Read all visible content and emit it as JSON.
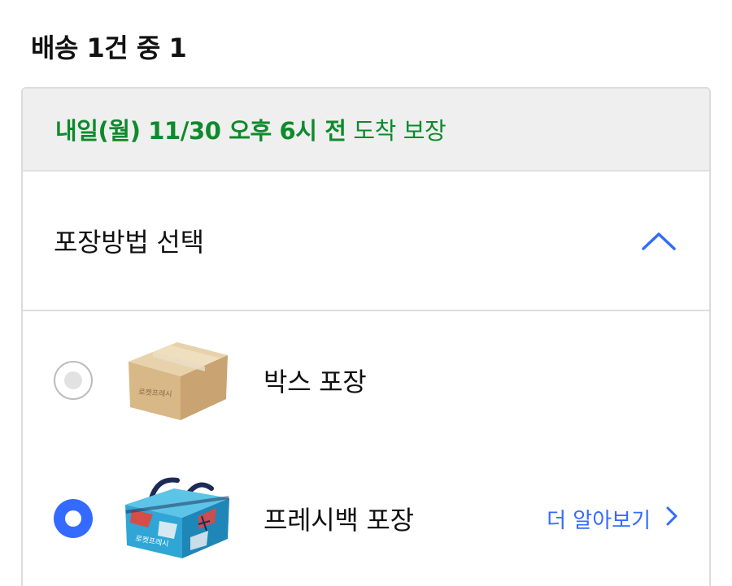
{
  "shipment": {
    "title": "배송 1건 중 1"
  },
  "delivery": {
    "promise_strong": "내일(월) 11/30 오후 6시 전",
    "promise_rest": " 도착 보장",
    "color": "#0e8a2c"
  },
  "packaging": {
    "title": "포장방법 선택",
    "toggle_icon": "chevron-up-icon",
    "options": [
      {
        "label": "박스 포장",
        "selected": false,
        "image_icon": "cardboard-box-icon",
        "image_text": "로켓프레시"
      },
      {
        "label": "프레시백 포장",
        "selected": true,
        "image_icon": "fresh-bag-icon",
        "image_text": "로켓프레시",
        "link_label": "더 알아보기",
        "link_icon": "chevron-right-icon"
      }
    ]
  },
  "colors": {
    "accent": "#346aff",
    "banner_bg": "#efefef",
    "border": "#dcdcdc"
  }
}
